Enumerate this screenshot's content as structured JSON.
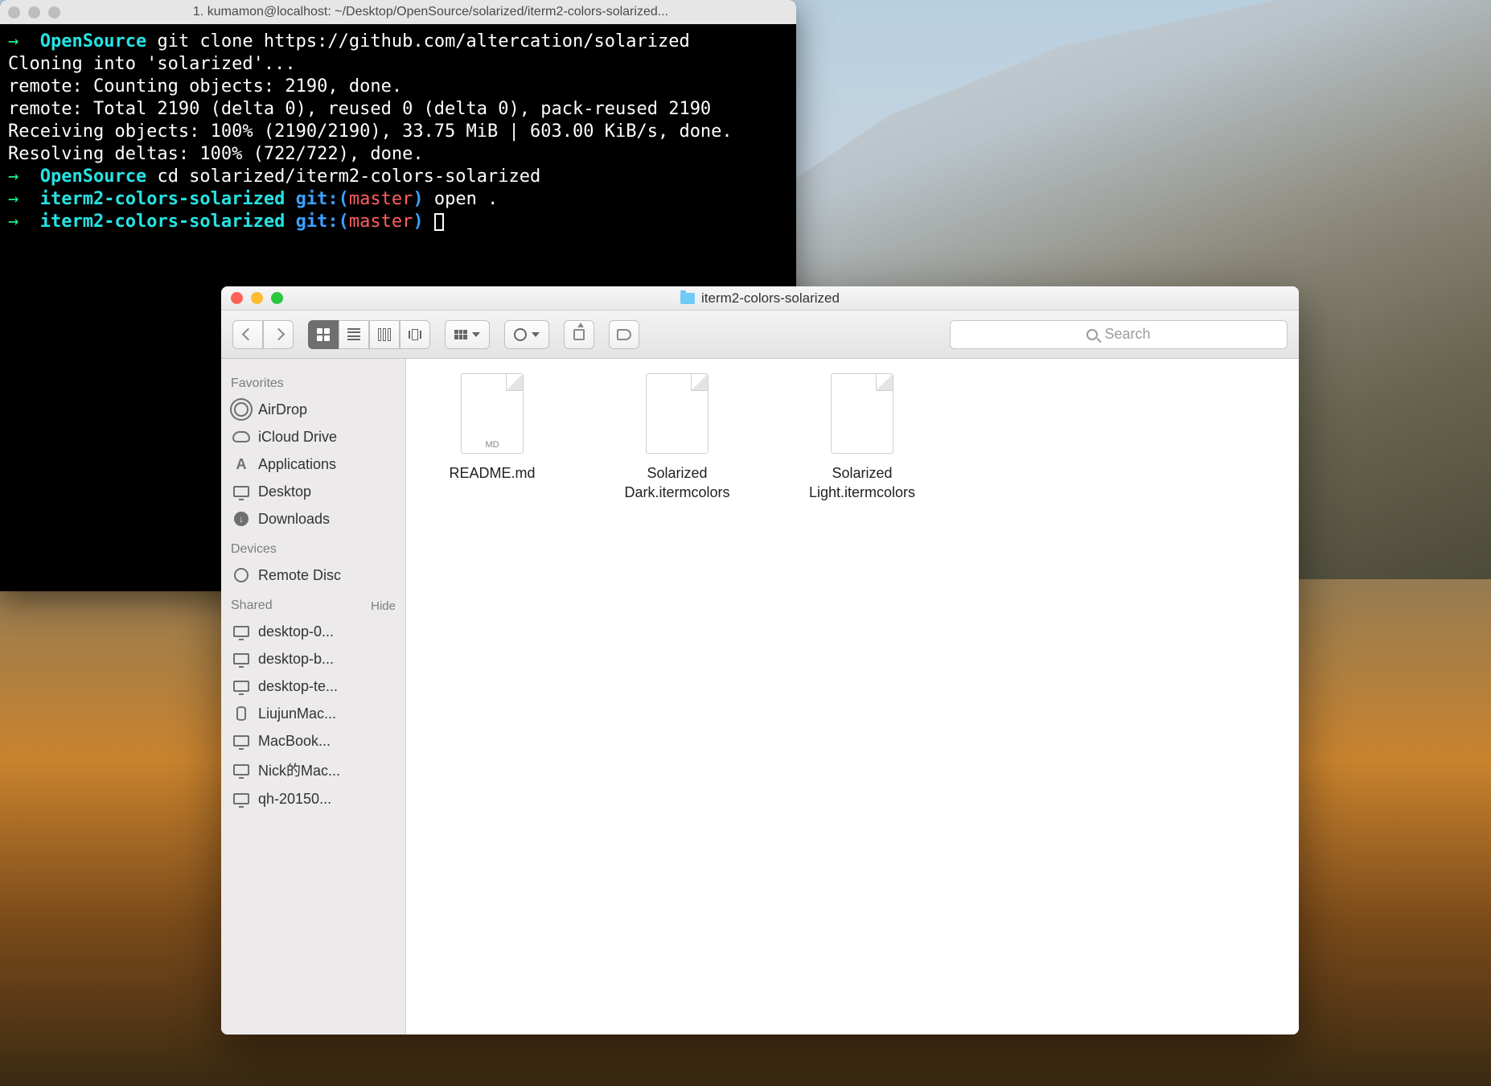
{
  "terminal": {
    "title": "1. kumamon@localhost: ~/Desktop/OpenSource/solarized/iterm2-colors-solarized...",
    "lines": [
      {
        "seg": [
          {
            "t": "→  ",
            "c": "arrow"
          },
          {
            "t": "OpenSource",
            "c": "cy"
          },
          {
            "t": " git clone https://github.com/altercation/solarized"
          }
        ]
      },
      {
        "seg": [
          {
            "t": "Cloning into 'solarized'..."
          }
        ]
      },
      {
        "seg": [
          {
            "t": "remote: Counting objects: 2190, done."
          }
        ]
      },
      {
        "seg": [
          {
            "t": "remote: Total 2190 (delta 0), reused 0 (delta 0), pack-reused 2190"
          }
        ]
      },
      {
        "seg": [
          {
            "t": "Receiving objects: 100% (2190/2190), 33.75 MiB | 603.00 KiB/s, done."
          }
        ]
      },
      {
        "seg": [
          {
            "t": "Resolving deltas: 100% (722/722), done."
          }
        ]
      },
      {
        "seg": [
          {
            "t": "→  ",
            "c": "arrow"
          },
          {
            "t": "OpenSource",
            "c": "cy"
          },
          {
            "t": " cd solarized/iterm2-colors-solarized"
          }
        ]
      },
      {
        "seg": [
          {
            "t": "→  ",
            "c": "arrow"
          },
          {
            "t": "iterm2-colors-solarized",
            "c": "cy"
          },
          {
            "t": " git:(",
            "c": "bl"
          },
          {
            "t": "master",
            "c": "rd"
          },
          {
            "t": ")",
            "c": "bl"
          },
          {
            "t": " open ."
          }
        ]
      },
      {
        "seg": [
          {
            "t": "→  ",
            "c": "arrow"
          },
          {
            "t": "iterm2-colors-solarized",
            "c": "cy"
          },
          {
            "t": " git:(",
            "c": "bl"
          },
          {
            "t": "master",
            "c": "rd"
          },
          {
            "t": ")",
            "c": "bl"
          },
          {
            "t": " "
          },
          {
            "cursor": true
          }
        ]
      }
    ]
  },
  "finder": {
    "title": "iterm2-colors-solarized",
    "search_placeholder": "Search",
    "sidebar": {
      "favorites_label": "Favorites",
      "favorites": [
        {
          "icon": "airdrop",
          "label": "AirDrop"
        },
        {
          "icon": "cloud",
          "label": "iCloud Drive"
        },
        {
          "icon": "apps",
          "label": "Applications"
        },
        {
          "icon": "desktop",
          "label": "Desktop"
        },
        {
          "icon": "downloads",
          "label": "Downloads"
        }
      ],
      "devices_label": "Devices",
      "devices": [
        {
          "icon": "disc",
          "label": "Remote Disc"
        }
      ],
      "shared_label": "Shared",
      "hide_label": "Hide",
      "shared": [
        {
          "icon": "mon",
          "label": "desktop-0..."
        },
        {
          "icon": "mon",
          "label": "desktop-b..."
        },
        {
          "icon": "mon",
          "label": "desktop-te..."
        },
        {
          "icon": "cyl",
          "label": "LiujunMac..."
        },
        {
          "icon": "mon",
          "label": "MacBook..."
        },
        {
          "icon": "mon",
          "label": "Nick的Mac..."
        },
        {
          "icon": "mon",
          "label": "qh-20150..."
        }
      ]
    },
    "files": [
      {
        "type": "md",
        "name": "README.md"
      },
      {
        "type": "file",
        "name": "Solarized Dark.itermcolors"
      },
      {
        "type": "file",
        "name": "Solarized Light.itermcolors"
      }
    ]
  }
}
